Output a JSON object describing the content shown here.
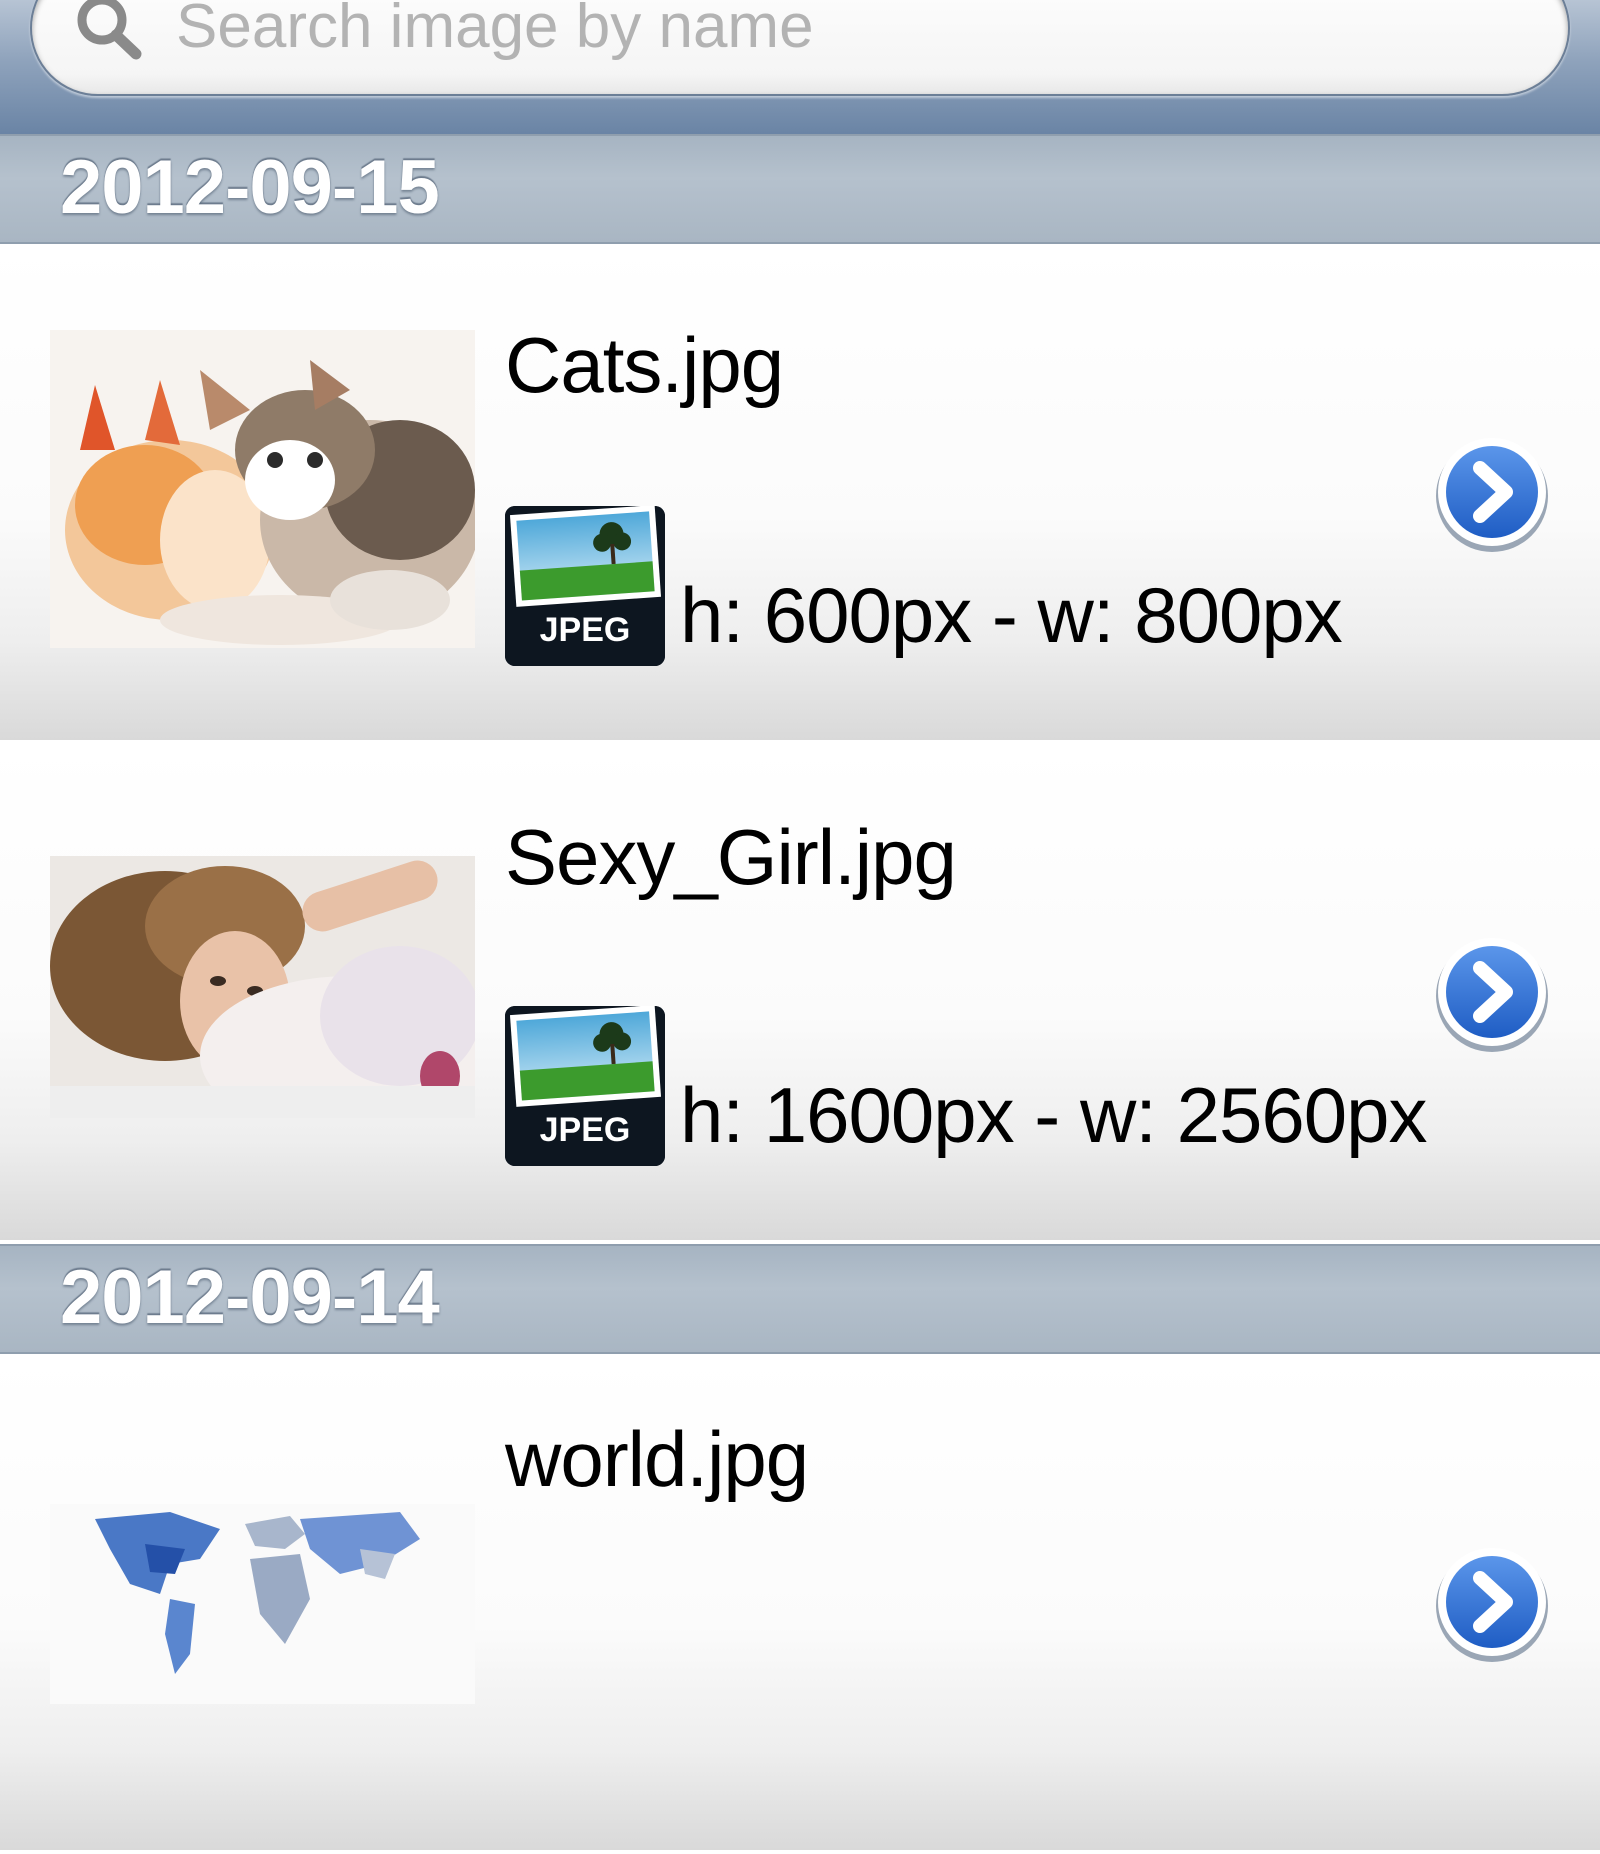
{
  "search": {
    "placeholder": "Search image by name",
    "value": ""
  },
  "sections": [
    {
      "date": "2012-09-15",
      "items": [
        {
          "name": "Cats.jpg",
          "format": "JPEG",
          "dims": "h: 600px - w: 800px",
          "thumb": "kittens-photo"
        },
        {
          "name": "Sexy_Girl.jpg",
          "format": "JPEG",
          "dims": "h: 1600px - w: 2560px",
          "thumb": "woman-photo"
        }
      ]
    },
    {
      "date": "2012-09-14",
      "items": [
        {
          "name": "world.jpg",
          "thumb": "world-map-photo"
        }
      ]
    }
  ],
  "icons": {
    "search": "magnifier-icon",
    "disclosure": "chevron-right-circle-icon",
    "file_type": "jpeg-file-icon"
  },
  "colors": {
    "accent_blue": "#2a6fd6",
    "header_text": "#ffffff",
    "section_bg": "#b0bcc9"
  }
}
